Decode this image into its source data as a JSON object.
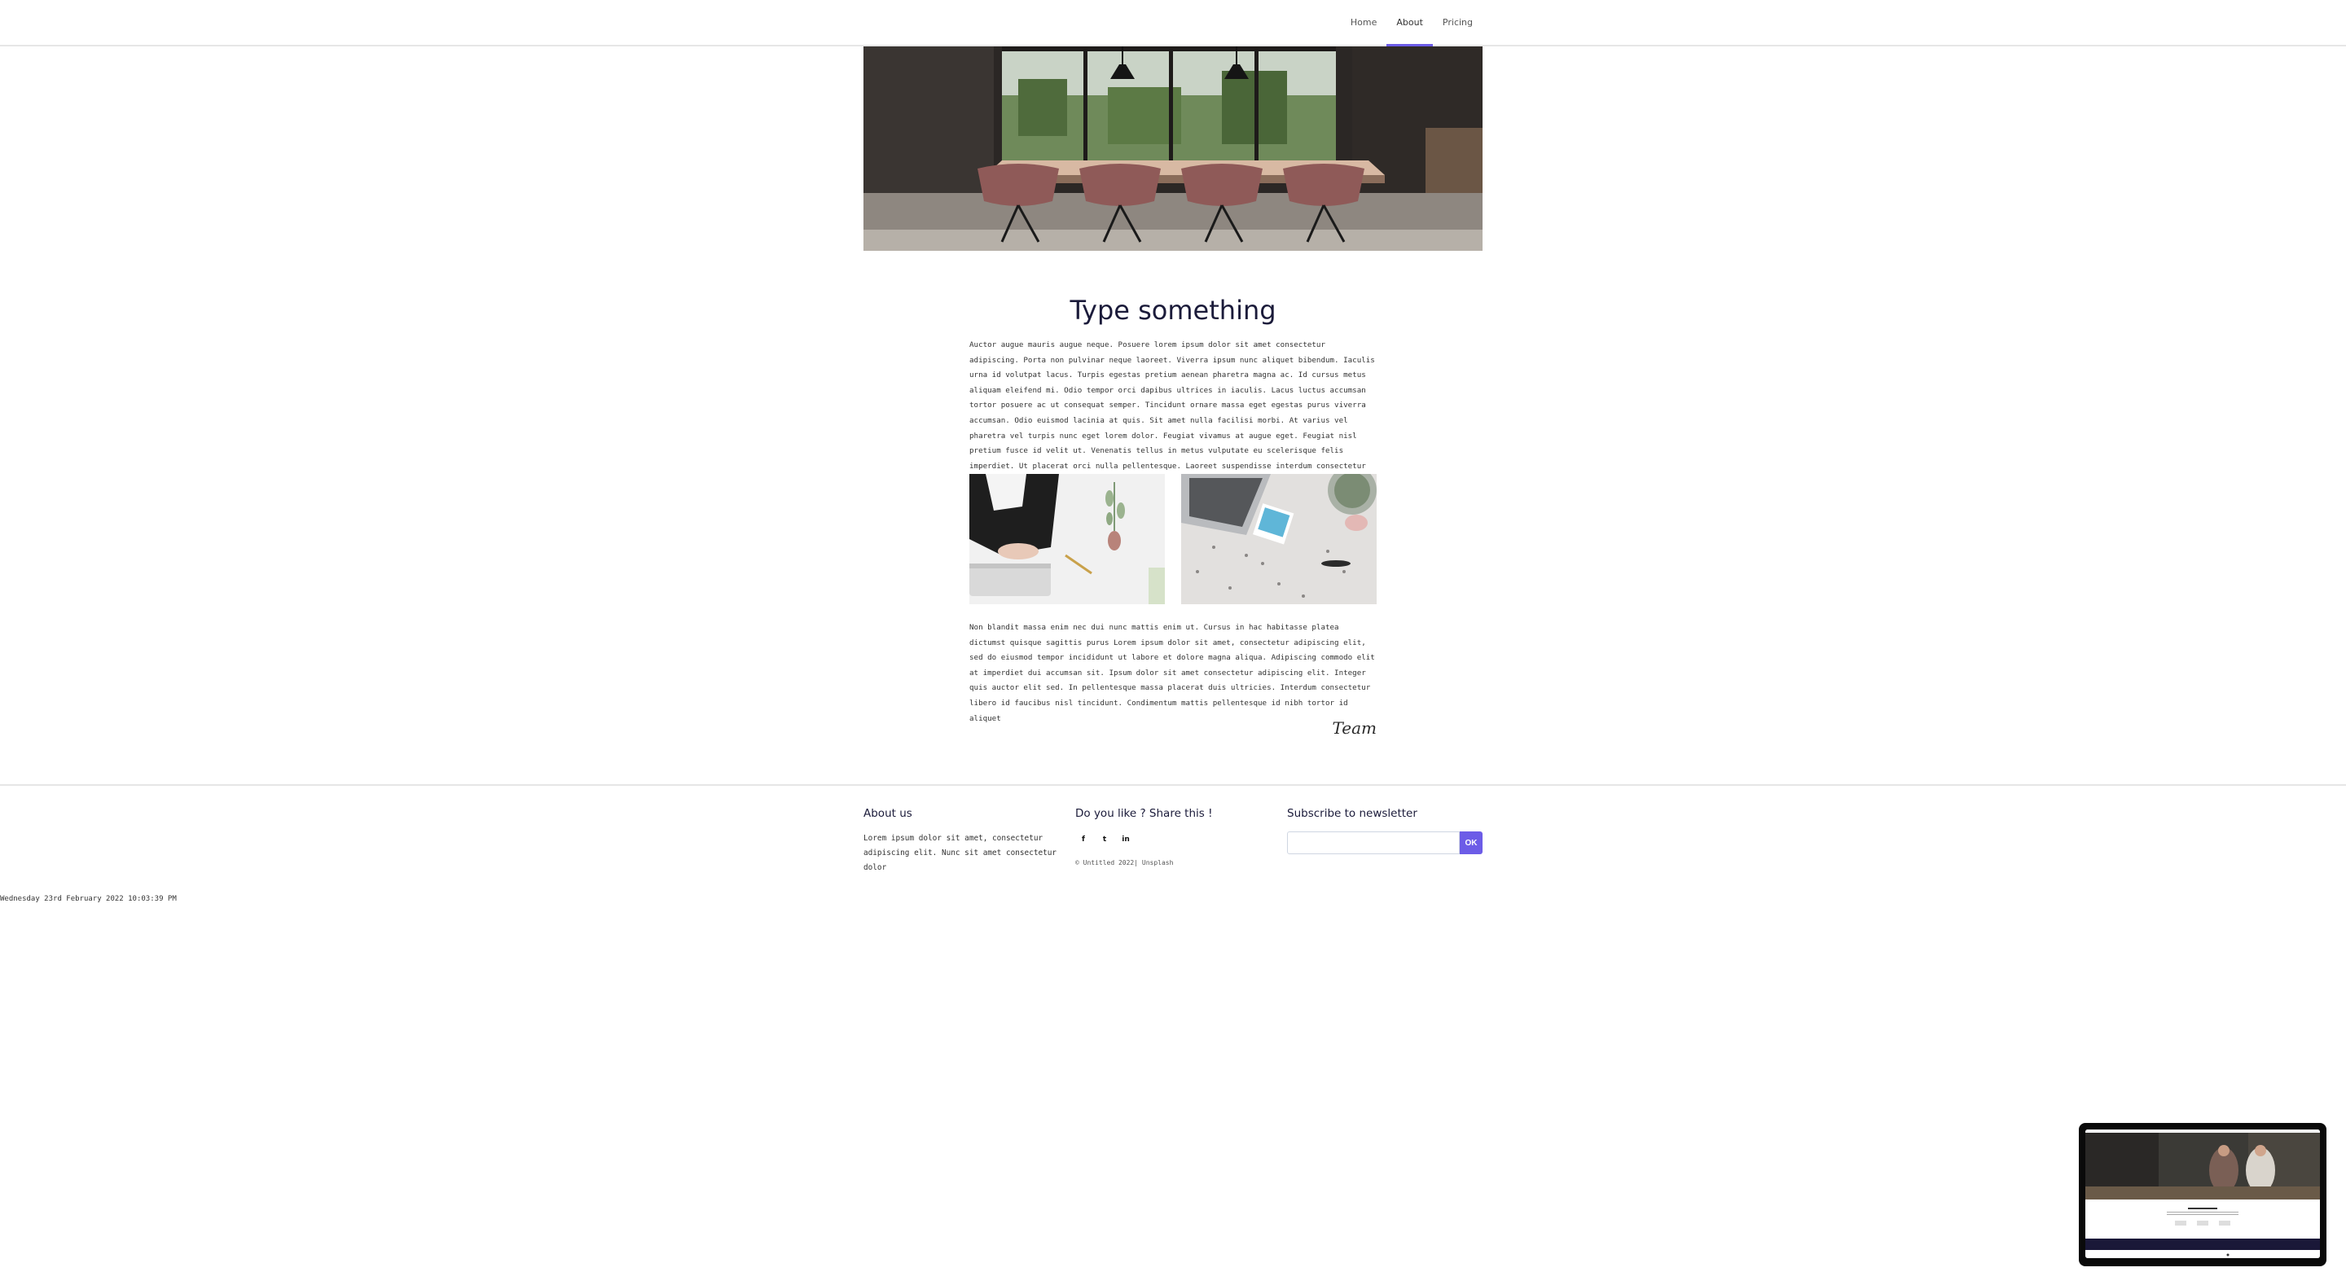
{
  "nav": {
    "items": [
      {
        "label": "Home",
        "active": false
      },
      {
        "label": "About",
        "active": true
      },
      {
        "label": "Pricing",
        "active": false
      }
    ],
    "accent_color": "#6c5ce7"
  },
  "article": {
    "title": "Type something",
    "paragraph1": "Auctor augue mauris augue neque. Posuere lorem ipsum dolor sit amet consectetur adipiscing. Porta non pulvinar neque laoreet. Viverra ipsum nunc aliquet bibendum. Iaculis urna id volutpat lacus. Turpis egestas pretium aenean pharetra magna ac. Id cursus metus aliquam eleifend mi. Odio tempor orci dapibus ultrices in iaculis. Lacus luctus accumsan tortor posuere ac ut consequat semper. Tincidunt ornare massa eget egestas purus viverra accumsan. Odio euismod lacinia at quis. Sit amet nulla facilisi morbi. At varius vel pharetra vel turpis nunc eget lorem dolor. Feugiat vivamus at augue eget. Feugiat nisl pretium fusce id velit ut. Venenatis tellus in metus vulputate eu scelerisque felis imperdiet. Ut placerat orci nulla pellentesque. Laoreet suspendisse interdum consectetur libero id.",
    "paragraph2": "Non blandit massa enim nec dui nunc mattis enim ut. Cursus in hac habitasse platea dictumst quisque sagittis purus Lorem ipsum dolor sit amet, consectetur adipiscing elit, sed do eiusmod tempor incididunt ut labore et dolore magna aliqua. Adipiscing commodo elit at imperdiet dui accumsan sit. Ipsum dolor sit amet consectetur adipiscing elit. Integer quis auctor elit sed. In pellentesque massa placerat duis ultricies. Interdum consectetur libero id faucibus nisl tincidunt. Condimentum mattis pellentesque id nibh tortor id aliquet",
    "signature": "Team"
  },
  "footer": {
    "about_heading": "About us",
    "about_text": "Lorem ipsum dolor sit amet, consectetur adipiscing elit. Nunc sit amet consectetur dolor",
    "share_heading": "Do you like ? Share this !",
    "social": [
      {
        "glyph": "f",
        "icon": "facebook-icon"
      },
      {
        "glyph": "t",
        "icon": "twitter-icon"
      },
      {
        "glyph": "in",
        "icon": "linkedin-icon"
      }
    ],
    "copyright": "© Untitled 2022| Unsplash",
    "newsletter_heading": "Subscribe to newsletter",
    "newsletter_placeholder": "",
    "newsletter_button": "OK"
  },
  "datetime": "Wednesday 23rd February 2022 10:03:39 PM"
}
